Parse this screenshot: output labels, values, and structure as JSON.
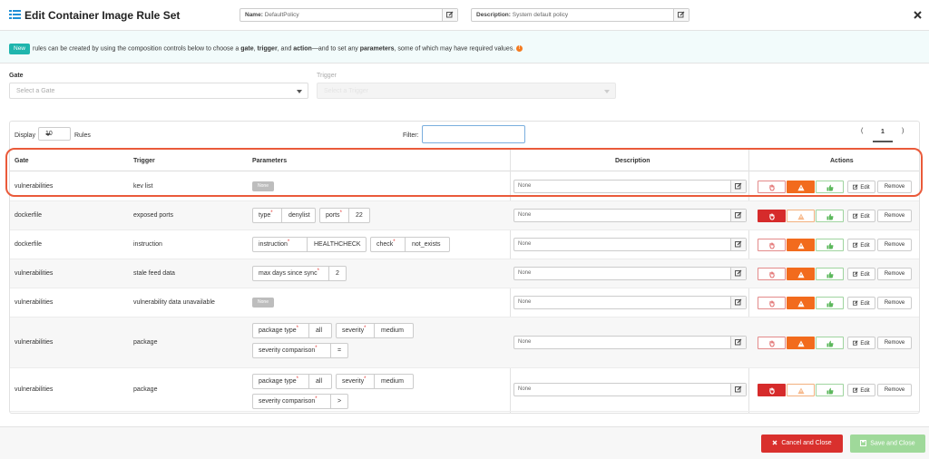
{
  "header": {
    "title": "Edit Container Image Rule Set",
    "name_label": "Name:",
    "name_value": "DefaultPolicy",
    "description_label": "Description:",
    "description_value": "System default policy"
  },
  "banner": {
    "badge": "New",
    "text_1": " rules can be created by using the composition controls below to choose a ",
    "gate": "gate",
    "sep_1": ", ",
    "trigger": "trigger",
    "sep_2": ", and ",
    "action": "action",
    "text_2": "—and to set any ",
    "parameters": "parameters",
    "text_3": ", some of which may have required values."
  },
  "selectors": {
    "gate_label": "Gate",
    "gate_placeholder": "Select a Gate",
    "trigger_label": "Trigger",
    "trigger_placeholder": "Select a Trigger"
  },
  "toolbar": {
    "display": "Display",
    "page_size": "10",
    "rules": "Rules",
    "filter_label": "Filter:",
    "prev": "(",
    "page": "1",
    "next": ")"
  },
  "columns": {
    "gate": "Gate",
    "trigger": "Trigger",
    "parameters": "Parameters",
    "description": "Description",
    "actions": "Actions"
  },
  "row_common": {
    "none_chip": "None",
    "desc_placeholder": "None",
    "edit": "Edit",
    "remove": "Remove"
  },
  "rows": [
    {
      "gate": "vulnerabilities",
      "trigger": "kev list",
      "action": "warn"
    },
    {
      "gate": "dockerfile",
      "trigger": "exposed ports",
      "action": "stop",
      "params": [
        {
          "key": "type",
          "value": "denylist"
        },
        {
          "key": "ports",
          "value": "22"
        }
      ]
    },
    {
      "gate": "dockerfile",
      "trigger": "instruction",
      "action": "warn",
      "params": [
        {
          "key": "instruction",
          "value": "HEALTHCHECK"
        },
        {
          "key": "check",
          "value": "not_exists"
        }
      ]
    },
    {
      "gate": "vulnerabilities",
      "trigger": "stale feed data",
      "action": "warn",
      "params": [
        {
          "key": "max days since sync",
          "value": "2"
        }
      ]
    },
    {
      "gate": "vulnerabilities",
      "trigger": "vulnerability data unavailable",
      "action": "warn"
    },
    {
      "gate": "vulnerabilities",
      "trigger": "package",
      "action": "warn",
      "params": [
        {
          "key": "package type",
          "value": "all"
        },
        {
          "key": "severity",
          "value": "medium"
        },
        {
          "key": "severity comparison",
          "value": "="
        }
      ]
    },
    {
      "gate": "vulnerabilities",
      "trigger": "package",
      "action": "stop",
      "params": [
        {
          "key": "package type",
          "value": "all"
        },
        {
          "key": "severity",
          "value": "medium"
        },
        {
          "key": "severity comparison",
          "value": ">"
        }
      ]
    }
  ],
  "footer": {
    "cancel": "Cancel and Close",
    "save": "Save and Close"
  },
  "colors": {
    "teal": "#1fb5ad",
    "stop": "#d62b2b",
    "warn": "#f26b1d",
    "go": "#9fd99a"
  }
}
